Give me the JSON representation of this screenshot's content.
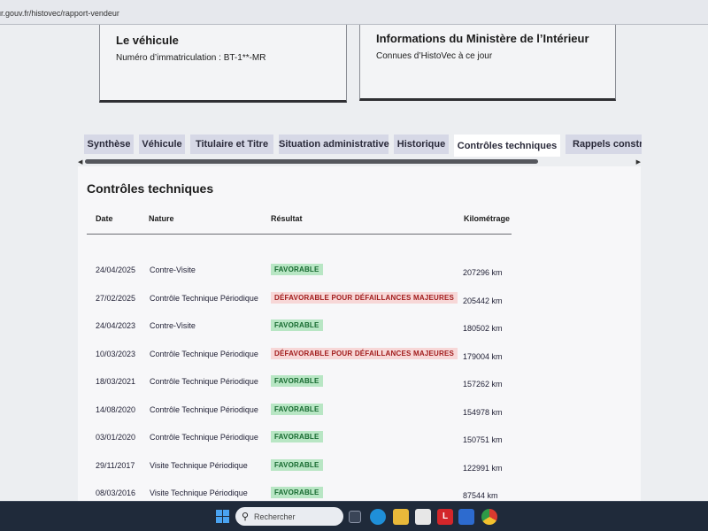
{
  "browser": {
    "url": "ur.gouv.fr/histovec/rapport-vendeur"
  },
  "vehicle_card": {
    "title": "Le véhicule",
    "plate_label": "Numéro d’immatriculation : BT-1**-MR"
  },
  "ministry_card": {
    "title": "Informations du Ministère de l’Intérieur",
    "text": "Connues d’HistoVec à ce jour"
  },
  "tabs": [
    {
      "label": "Synthèse"
    },
    {
      "label": "Véhicule"
    },
    {
      "label": "Titulaire et Titre"
    },
    {
      "label": "Situation administrative"
    },
    {
      "label": "Historique"
    },
    {
      "label": "Contrôles techniques"
    },
    {
      "label": "Rappels constructeur"
    }
  ],
  "active_tab": "Contrôles techniques",
  "section": {
    "title": "Contrôles techniques",
    "columns": {
      "date": "Date",
      "nature": "Nature",
      "result": "Résultat",
      "mileage": "Kilométrage"
    },
    "rows": [
      {
        "date": "24/04/2025",
        "nature": "Contre-Visite",
        "result": "FAVORABLE",
        "status": "fav",
        "km": "207296 km"
      },
      {
        "date": "27/02/2025",
        "nature": "Contrôle Technique Périodique",
        "result": "DÉFAVORABLE POUR DÉFAILLANCES MAJEURES",
        "status": "defav",
        "km": "205442 km"
      },
      {
        "date": "24/04/2023",
        "nature": "Contre-Visite",
        "result": "FAVORABLE",
        "status": "fav",
        "km": "180502 km"
      },
      {
        "date": "10/03/2023",
        "nature": "Contrôle Technique Périodique",
        "result": "DÉFAVORABLE POUR DÉFAILLANCES MAJEURES",
        "status": "defav",
        "km": "179004 km"
      },
      {
        "date": "18/03/2021",
        "nature": "Contrôle Technique Périodique",
        "result": "FAVORABLE",
        "status": "fav",
        "km": "157262 km"
      },
      {
        "date": "14/08/2020",
        "nature": "Contrôle Technique Périodique",
        "result": "FAVORABLE",
        "status": "fav",
        "km": "154978 km"
      },
      {
        "date": "03/01/2020",
        "nature": "Contrôle Technique Périodique",
        "result": "FAVORABLE",
        "status": "fav",
        "km": "150751 km"
      },
      {
        "date": "29/11/2017",
        "nature": "Visite Technique Périodique",
        "result": "FAVORABLE",
        "status": "fav",
        "km": "122991 km"
      },
      {
        "date": "08/03/2016",
        "nature": "Visite Technique Périodique",
        "result": "FAVORABLE",
        "status": "fav",
        "km": "87544 km"
      }
    ]
  },
  "taskbar": {
    "search_placeholder": "Rechercher",
    "icons": [
      "windows-start-icon",
      "search-icon",
      "task-view-icon",
      "edge-icon",
      "file-explorer-icon",
      "store-icon",
      "app-l-icon",
      "mail-icon",
      "chrome-icon"
    ]
  },
  "colors": {
    "favorable_bg": "#b8e6c4",
    "favorable_text": "#176a30",
    "defavorable_bg": "#f7d7d7",
    "defavorable_text": "#a11c1c",
    "active_tab_border": "#1f1f6e"
  }
}
